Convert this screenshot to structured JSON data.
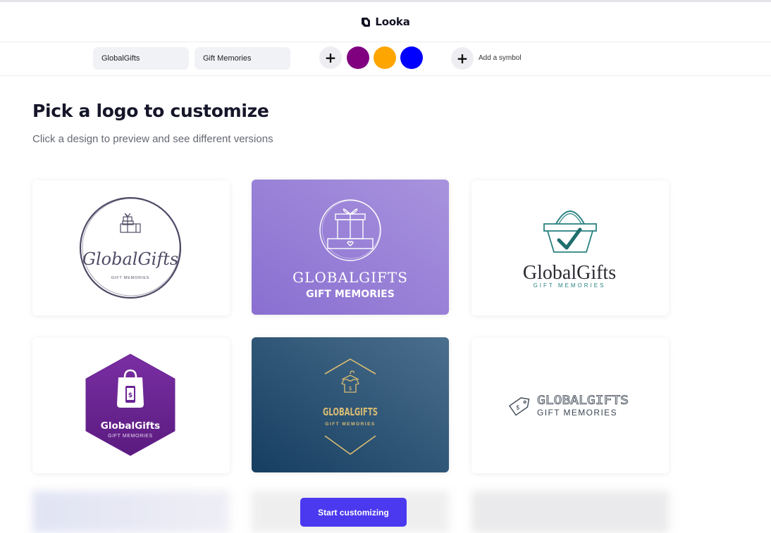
{
  "header": {
    "brand_name": "Looka",
    "logo_icon": "looka-mark-icon"
  },
  "toolbar": {
    "business_name": "GlobalGifts",
    "slogan": "Gift Memories",
    "add_color_icon": "plus-icon",
    "colors": [
      "#800080",
      "#FFA500",
      "#0000FF"
    ],
    "add_symbol_label": "Add a symbol",
    "add_symbol_icon": "plus-icon"
  },
  "main": {
    "title": "Pick a logo to customize",
    "subtitle": "Click a design to preview and see different versions"
  },
  "logos": [
    {
      "background": "#ffffff",
      "symbol": "gift-boxes-icon",
      "name": "GlobalGifts",
      "slogan": "GIFT MEMORIES",
      "color": "#4f4b66"
    },
    {
      "background": "#9077d4",
      "symbol": "gift-box-circle-icon",
      "name": "GLOBALGIFTS",
      "slogan": "GIFT MEMORIES",
      "color": "#ffffff"
    },
    {
      "background": "#ffffff",
      "symbol": "shopping-basket-check-icon",
      "name": "GlobalGifts",
      "slogan": "GIFT MEMORIES",
      "color": "#2b2b33",
      "accent": "#2a8281"
    },
    {
      "background": "#ffffff",
      "symbol": "shopping-bag-phone-icon",
      "name": "GlobalGifts",
      "slogan": "GIFT MEMORIES",
      "color": "#ffffff",
      "accent": "#6b2494"
    },
    {
      "background": "#1c4766",
      "symbol": "tshirt-hanger-icon",
      "name": "GLOBALGIFTS",
      "slogan": "GIFT MEMORIES",
      "color": "#d9bc72"
    },
    {
      "background": "#ffffff",
      "symbol": "price-tag-icon",
      "name": "GLOBALGIFTS",
      "slogan": "GIFT MEMORIES",
      "color": "#3c4654"
    }
  ],
  "cta": {
    "label": "Start customizing"
  }
}
